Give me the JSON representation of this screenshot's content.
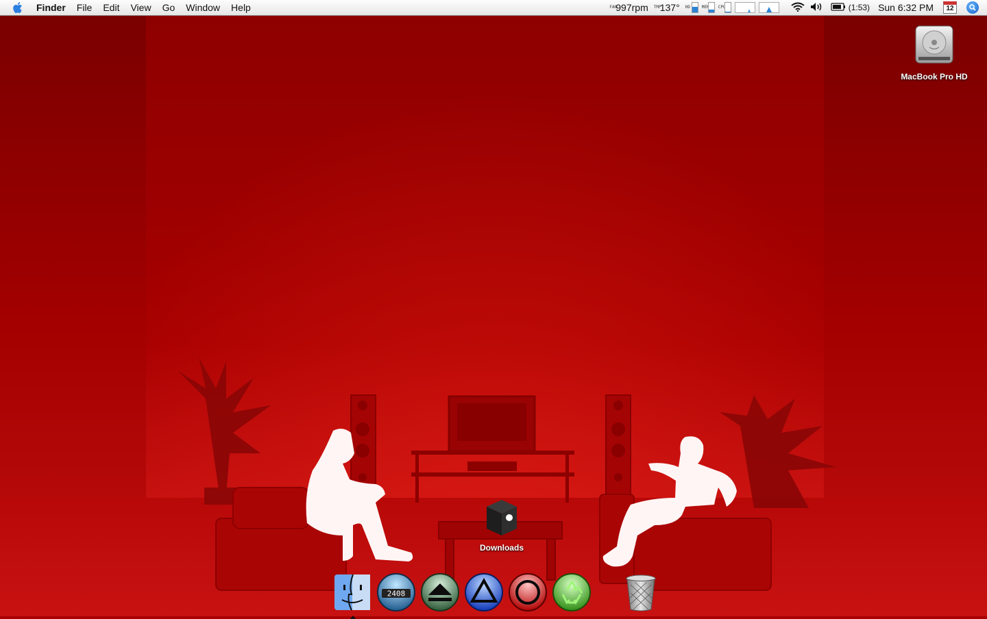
{
  "menubar": {
    "app_name": "Finder",
    "items": [
      "File",
      "Edit",
      "View",
      "Go",
      "Window",
      "Help"
    ],
    "fan_label": "FAN",
    "fan_speed": "997rpm",
    "temp_label": "TMP",
    "temperature": "137°",
    "hd_label": "HD",
    "mem_label": "MEM",
    "cpu_label": "CPU",
    "battery_time": "(1:53)",
    "clock": "Sun 6:32 PM",
    "calendar_day": "12"
  },
  "desktop": {
    "icons": [
      {
        "label": "MacBook Pro HD",
        "icon": "hard-drive-icon"
      },
      {
        "label": "Downloads",
        "icon": "downloads-box-icon"
      }
    ]
  },
  "dock": {
    "items": [
      {
        "name": "finder",
        "icon": "finder-icon"
      },
      {
        "name": "counter",
        "icon": "counter-orb-icon",
        "digits": "2408"
      },
      {
        "name": "eject",
        "icon": "eject-orb-icon"
      },
      {
        "name": "triangle",
        "icon": "triangle-orb-icon"
      },
      {
        "name": "record",
        "icon": "circle-orb-icon"
      },
      {
        "name": "recycle",
        "icon": "recycle-orb-icon"
      },
      {
        "name": "trash",
        "icon": "trash-icon"
      }
    ]
  },
  "colors": {
    "wallpaper": "#a00000",
    "silhouette": "#fff5f5",
    "accent_blue": "#2c84d8"
  }
}
